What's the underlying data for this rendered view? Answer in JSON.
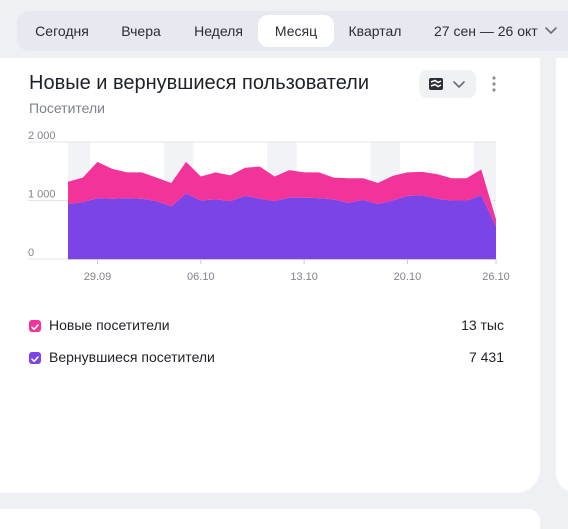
{
  "periods": [
    {
      "label": "Сегодня",
      "active": false
    },
    {
      "label": "Вчера",
      "active": false
    },
    {
      "label": "Неделя",
      "active": false
    },
    {
      "label": "Месяц",
      "active": true
    },
    {
      "label": "Квартал",
      "active": false
    }
  ],
  "date_range": "27 сен — 26 окт",
  "card": {
    "title": "Новые и вернувшиеся пользователи",
    "subtitle": "Посетители",
    "toggle_icon": "stacked-area-icon",
    "more_icon": "more-vertical-icon"
  },
  "chart_data": {
    "type": "area",
    "stacked": true,
    "ylim": [
      0,
      2000
    ],
    "yticks": [
      0,
      1000,
      2000
    ],
    "ytick_labels": [
      "0",
      "1 000",
      "2 000"
    ],
    "x": [
      "2024-09-27",
      "2024-09-28",
      "2024-09-29",
      "2024-09-30",
      "2024-10-01",
      "2024-10-02",
      "2024-10-03",
      "2024-10-04",
      "2024-10-05",
      "2024-10-06",
      "2024-10-07",
      "2024-10-08",
      "2024-10-09",
      "2024-10-10",
      "2024-10-11",
      "2024-10-12",
      "2024-10-13",
      "2024-10-14",
      "2024-10-15",
      "2024-10-16",
      "2024-10-17",
      "2024-10-18",
      "2024-10-19",
      "2024-10-20",
      "2024-10-21",
      "2024-10-22",
      "2024-10-23",
      "2024-10-24",
      "2024-10-25",
      "2024-10-26"
    ],
    "xtick_labels": [
      "29.09",
      "06.10",
      "13.10",
      "20.10",
      "26.10"
    ],
    "xtick_index": [
      2,
      9,
      16,
      23,
      29
    ],
    "weekend_index": [
      [
        0,
        1
      ],
      [
        7,
        8
      ],
      [
        14,
        15
      ],
      [
        21,
        22
      ],
      [
        28,
        29
      ]
    ],
    "series": [
      {
        "name": "Вернувшиеся посетители",
        "color": "#7b44e6",
        "values": [
          940,
          970,
          1040,
          1030,
          1040,
          1030,
          990,
          900,
          1120,
          1000,
          1020,
          990,
          1080,
          1030,
          990,
          1050,
          1050,
          1040,
          1020,
          960,
          1010,
          940,
          1000,
          1080,
          1090,
          1030,
          1000,
          1000,
          1090,
          560
        ]
      },
      {
        "name": "Новые посетители",
        "color": "#f2339a",
        "values": [
          380,
          420,
          620,
          510,
          440,
          450,
          400,
          400,
          540,
          410,
          460,
          440,
          480,
          550,
          420,
          470,
          430,
          440,
          370,
          420,
          370,
          360,
          420,
          400,
          400,
          420,
          380,
          380,
          440,
          120
        ]
      }
    ]
  },
  "legend": [
    {
      "label": "Новые посетители",
      "value": "13 тыс",
      "color": "#f2339a"
    },
    {
      "label": "Вернувшиеся посетители",
      "value": "7 431",
      "color": "#7b44e6"
    }
  ]
}
